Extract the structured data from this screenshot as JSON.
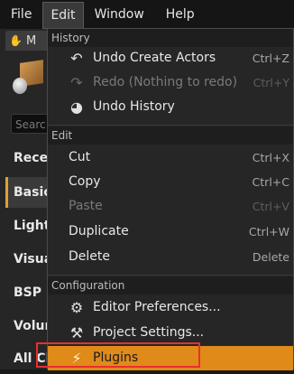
{
  "menubar": {
    "items": [
      "File",
      "Edit",
      "Window",
      "Help"
    ]
  },
  "left_panel": {
    "tab_label": "M",
    "search_placeholder": "Searc",
    "categories": [
      "Rece",
      "Basic",
      "Light",
      "Visua",
      "BSP",
      "Volur",
      "All Cl"
    ]
  },
  "dropdown": {
    "history": {
      "header": "History",
      "items": [
        {
          "label": "Undo Create Actors",
          "shortcut": "Ctrl+Z",
          "icon": "undo-icon",
          "disabled": false
        },
        {
          "label": "Redo (Nothing to redo)",
          "shortcut": "Ctrl+Y",
          "icon": "redo-icon",
          "disabled": true
        },
        {
          "label": "Undo History",
          "shortcut": "",
          "icon": "history-icon",
          "disabled": false
        }
      ]
    },
    "edit": {
      "header": "Edit",
      "items": [
        {
          "label": "Cut",
          "shortcut": "Ctrl+X",
          "disabled": false
        },
        {
          "label": "Copy",
          "shortcut": "Ctrl+C",
          "disabled": false
        },
        {
          "label": "Paste",
          "shortcut": "Ctrl+V",
          "disabled": true
        },
        {
          "label": "Duplicate",
          "shortcut": "Ctrl+W",
          "disabled": false
        },
        {
          "label": "Delete",
          "shortcut": "Delete",
          "disabled": false
        }
      ]
    },
    "configuration": {
      "header": "Configuration",
      "items": [
        {
          "label": "Editor Preferences...",
          "icon": "editor-preferences-icon"
        },
        {
          "label": "Project Settings...",
          "icon": "project-settings-icon"
        },
        {
          "label": "Plugins",
          "icon": "plugins-icon"
        }
      ]
    }
  },
  "colors": {
    "highlight": "#e08a1a",
    "annotation_frame": "#e82e2e"
  }
}
